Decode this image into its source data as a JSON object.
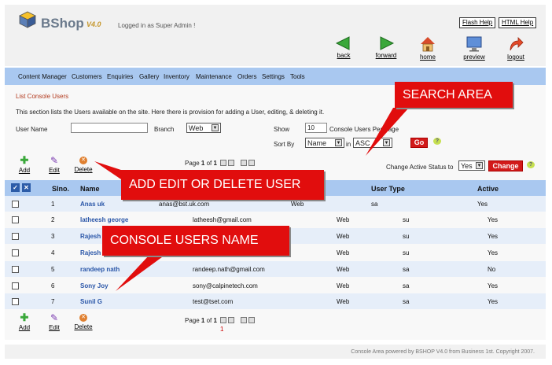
{
  "header": {
    "brand": "BShop",
    "version": "V4.0",
    "logged_in": "Logged in as Super Admin !",
    "flash_help": "Flash Help",
    "html_help": "HTML Help"
  },
  "toolbar": {
    "back": "back",
    "forward": "forward",
    "home": "home",
    "preview": "preview",
    "logout": "logout"
  },
  "nav": [
    "Content Manager",
    "Customers",
    "Enquiries",
    "Gallery",
    "Inventory",
    "Maintenance",
    "Orders",
    "Settings",
    "Tools"
  ],
  "page": {
    "breadcrumb": "List Console Users",
    "description": "This section lists the Users available on the site. Here there is provision for adding a User, editing, & deleting it."
  },
  "filters": {
    "username_label": "User Name",
    "username_value": "",
    "branch_label": "Branch",
    "branch_value": "Web",
    "show_label": "Show",
    "show_value": "10",
    "per_page_label": "Console Users Per Page",
    "sortby_label": "Sort By",
    "sort_field": "Name",
    "in_label": "in",
    "sort_order": "ASC",
    "go": "Go",
    "help": "?"
  },
  "actions": {
    "add": "Add",
    "edit": "Edit",
    "delete": "Delete",
    "pager_prefix": "Page",
    "pager_page": "1",
    "pager_of": "of",
    "pager_total": "1",
    "change_status_label": "Change Active Status to",
    "status_value": "Yes",
    "change": "Change",
    "page_link": "1"
  },
  "table": {
    "headers": {
      "slno": "Slno.",
      "name": "Name",
      "user_type": "User Type",
      "active": "Active"
    },
    "rows": [
      {
        "slno": "1",
        "name": "Anas uk",
        "email": "anas@bst.uk.com",
        "branch": "Web",
        "type": "sa",
        "active": "Yes"
      },
      {
        "slno": "2",
        "name": "latheesh george",
        "email": "latheesh@gmail.com",
        "branch": "Web",
        "type": "su",
        "active": "Yes"
      },
      {
        "slno": "3",
        "name": "Rajesh",
        "email": "",
        "branch": "Web",
        "type": "su",
        "active": "Yes"
      },
      {
        "slno": "4",
        "name": "Rajesh",
        "email": "",
        "branch": "Web",
        "type": "su",
        "active": "Yes"
      },
      {
        "slno": "5",
        "name": "randeep nath",
        "email": "randeep.nath@gmail.com",
        "branch": "Web",
        "type": "sa",
        "active": "No"
      },
      {
        "slno": "6",
        "name": "Sony Joy",
        "email": "sony@calpinetech.com",
        "branch": "Web",
        "type": "sa",
        "active": "Yes"
      },
      {
        "slno": "7",
        "name": "Sunil G",
        "email": "test@tset.com",
        "branch": "Web",
        "type": "sa",
        "active": "Yes"
      }
    ]
  },
  "callouts": {
    "search": "SEARCH AREA",
    "add_edit": "ADD EDIT OR DELETE USER",
    "names": "CONSOLE USERS NAME"
  },
  "footer": "Console Area powered by BSHOP V4.0 from Business 1st. Copyright 2007.",
  "colors": {
    "accent": "#a9c8f0",
    "callout": "#e10d0d",
    "button": "#d21a1a"
  }
}
